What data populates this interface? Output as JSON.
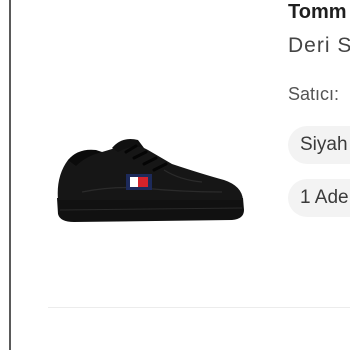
{
  "product": {
    "brand": "Tomm",
    "name": "Deri S",
    "seller_label": "Satıcı:",
    "color_chip": "Siyah",
    "quantity_chip": "1 Ade",
    "image_icon": "black-sneaker-image"
  },
  "colors": {
    "chip_bg": "#f3f3f3",
    "text_dark": "#1f1f1f",
    "flag_red": "#d5232b",
    "flag_navy": "#1d2a5a"
  }
}
